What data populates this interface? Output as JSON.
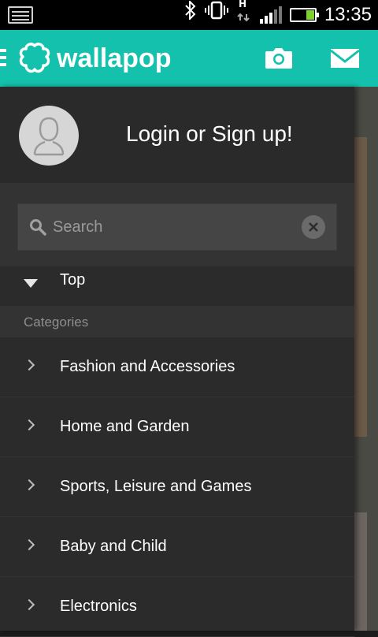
{
  "status_bar": {
    "time": "13:35",
    "icons": [
      "screenshot-icon",
      "bluetooth-icon",
      "vibrate-icon",
      "hspa-data-icon",
      "signal-icon",
      "battery-icon"
    ]
  },
  "header": {
    "brand": "wallapop",
    "color": "#13c1ac",
    "menu_icon": "hamburger-icon",
    "camera_icon": "camera-icon",
    "mail_icon": "mail-icon"
  },
  "drawer": {
    "login_text": "Login or Sign up!",
    "search": {
      "placeholder": "Search",
      "value": ""
    },
    "top_label": "Top",
    "categories_header": "Categories",
    "categories": [
      {
        "label": "Fashion and Accessories"
      },
      {
        "label": "Home and Garden"
      },
      {
        "label": "Sports, Leisure and Games"
      },
      {
        "label": "Baby and Child"
      },
      {
        "label": "Electronics"
      }
    ]
  }
}
